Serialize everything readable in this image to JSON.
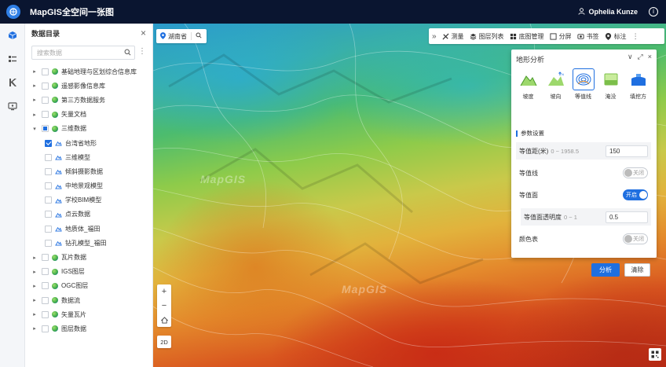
{
  "header": {
    "app_title": "MapGIS全空间一张图",
    "user_name": "Ophelia Kunze"
  },
  "catalog": {
    "title": "数据目录",
    "search_placeholder": "搜索数据",
    "items": [
      {
        "label": "基础地理与区划综合信息库",
        "level": 0,
        "expanded": false,
        "checked": false
      },
      {
        "label": "遥感影像信息库",
        "level": 0,
        "expanded": false,
        "checked": false
      },
      {
        "label": "第三方数据服务",
        "level": 0,
        "expanded": false,
        "checked": false
      },
      {
        "label": "矢量文档",
        "level": 0,
        "expanded": false,
        "checked": false
      },
      {
        "label": "三维数据",
        "level": 0,
        "expanded": true,
        "checked": "partial"
      },
      {
        "label": "台湾省地形",
        "level": 1,
        "checked": true
      },
      {
        "label": "三维模型",
        "level": 1,
        "checked": false
      },
      {
        "label": "倾斜摄影数据",
        "level": 1,
        "checked": false
      },
      {
        "label": "中地景观模型",
        "level": 1,
        "checked": false
      },
      {
        "label": "学校BIM模型",
        "level": 1,
        "checked": false
      },
      {
        "label": "点云数据",
        "level": 1,
        "checked": false
      },
      {
        "label": "地质体_福田",
        "level": 1,
        "checked": false
      },
      {
        "label": "钻孔模型_福田",
        "level": 1,
        "checked": false
      },
      {
        "label": "瓦片数据",
        "level": 0,
        "expanded": false,
        "checked": false
      },
      {
        "label": "IGS图层",
        "level": 0,
        "expanded": false,
        "checked": false
      },
      {
        "label": "OGC图层",
        "level": 0,
        "expanded": false,
        "checked": false
      },
      {
        "label": "数据流",
        "level": 0,
        "expanded": false,
        "checked": false
      },
      {
        "label": "矢量瓦片",
        "level": 0,
        "expanded": false,
        "checked": false
      },
      {
        "label": "图层数据",
        "level": 0,
        "expanded": false,
        "checked": false
      }
    ]
  },
  "map": {
    "location": "湖南省",
    "watermark": "MapGIS",
    "toolbar": [
      {
        "label": "测量",
        "icon": "ruler-icon"
      },
      {
        "label": "图层列表",
        "icon": "layers-icon"
      },
      {
        "label": "底图管理",
        "icon": "grid-icon"
      },
      {
        "label": "分屏",
        "icon": "split-icon"
      },
      {
        "label": "书签",
        "icon": "bookmark-icon"
      },
      {
        "label": "标注",
        "icon": "pin-icon"
      }
    ],
    "zoom_in": "+",
    "zoom_out": "−",
    "mode_2d": "2D"
  },
  "analysis": {
    "title": "地形分析",
    "tools": [
      {
        "label": "坡度",
        "active": false
      },
      {
        "label": "坡向",
        "active": false
      },
      {
        "label": "等值线",
        "active": true
      },
      {
        "label": "淹没",
        "active": false
      },
      {
        "label": "填挖方",
        "active": false
      }
    ],
    "section_title": "参数设置",
    "contour_interval": {
      "label": "等值距(米)",
      "hint": "0 ~ 1958.5",
      "value": "150"
    },
    "contour_line": {
      "label": "等值线",
      "state": "关闭"
    },
    "contour_surface": {
      "label": "等值面",
      "state": "开启"
    },
    "surface_opacity": {
      "label": "等值面透明度",
      "hint": "0 ~ 1",
      "value": "0.5"
    },
    "color_table": {
      "label": "颜色表",
      "state": "关闭"
    },
    "analyze_button": "分析",
    "clear_button": "清除"
  },
  "colors": {
    "header_bg": "#0a1530",
    "accent": "#1f6fe0"
  }
}
